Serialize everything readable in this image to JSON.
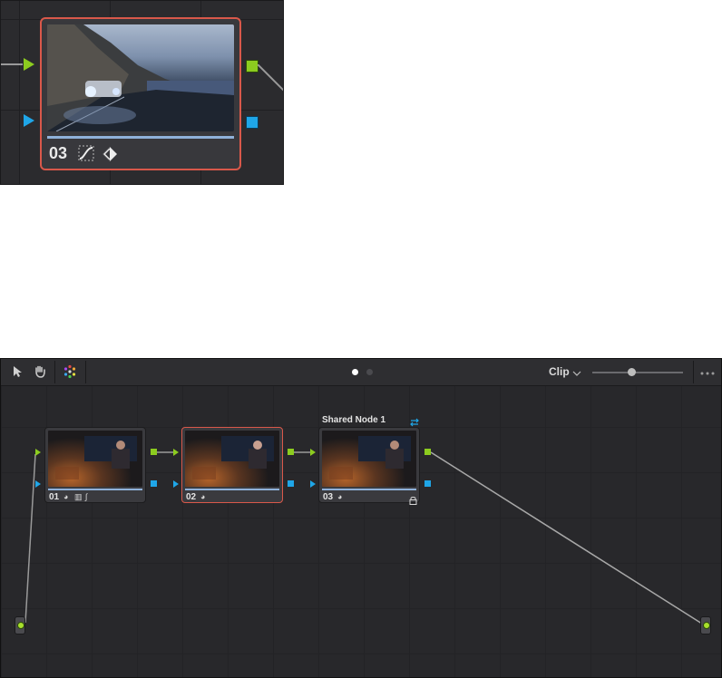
{
  "zoom_inset": {
    "node_label": "03",
    "icons": [
      "curves-icon",
      "key-icon"
    ]
  },
  "toolbar": {
    "icons": [
      "pointer-icon",
      "hand-icon",
      "color-wheel-icon"
    ],
    "page_dots": [
      "active",
      "inactive"
    ],
    "clip_label": "Clip",
    "dropdown_icon": "chevron-down-icon",
    "zoom_slider_value": 0.5,
    "more_icon": "more-icon"
  },
  "nodes": [
    {
      "label": "01",
      "icons": [
        "color-icon",
        "bars-icon",
        "curves-icon"
      ],
      "selected": false
    },
    {
      "label": "02",
      "icons": [
        "color-icon"
      ],
      "selected": true
    },
    {
      "label": "03",
      "icons": [
        "color-icon"
      ],
      "title": "Shared Node 1",
      "locked": true,
      "selected": false
    }
  ],
  "colors": {
    "selection": "#d9584a",
    "green_port": "#8ccc1f",
    "blue_port": "#1fa6e8",
    "canvas": "#28282b"
  }
}
